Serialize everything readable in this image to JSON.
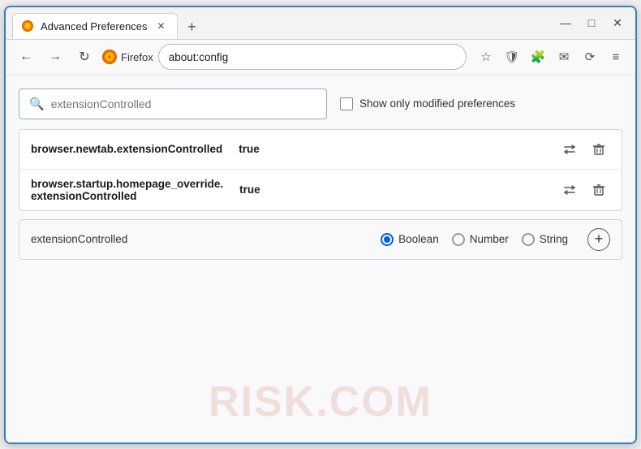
{
  "window": {
    "title": "Advanced Preferences",
    "new_tab_btn": "+",
    "minimize": "—",
    "maximize": "□",
    "close": "✕"
  },
  "navbar": {
    "back": "←",
    "forward": "→",
    "reload": "↻",
    "brand": "Firefox",
    "address": "about:config",
    "star": "☆",
    "shield": "🛡",
    "extension": "🧩",
    "email": "✉",
    "sync": "⟳",
    "menu": "≡"
  },
  "search": {
    "placeholder": "extensionControlled",
    "value": "extensionControlled",
    "show_modified_label": "Show only modified preferences"
  },
  "results": [
    {
      "name": "browser.newtab.extensionControlled",
      "value": "true",
      "swap_icon": "⇌",
      "delete_icon": "🗑"
    },
    {
      "name": "browser.startup.homepage_override.\nextensionControlled",
      "name_line1": "browser.startup.homepage_override.",
      "name_line2": "extensionControlled",
      "value": "true",
      "swap_icon": "⇌",
      "delete_icon": "🗑"
    }
  ],
  "add_pref": {
    "name": "extensionControlled",
    "types": [
      {
        "label": "Boolean",
        "selected": true
      },
      {
        "label": "Number",
        "selected": false
      },
      {
        "label": "String",
        "selected": false
      }
    ],
    "add_btn": "+"
  },
  "watermark": "RISK.COM"
}
